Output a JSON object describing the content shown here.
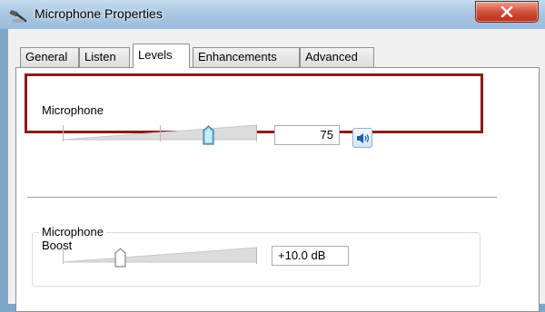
{
  "window": {
    "title": "Microphone Properties",
    "icon": "microphone-icon",
    "close_icon": "close-icon"
  },
  "tabs": [
    {
      "label": "General",
      "active": false
    },
    {
      "label": "Listen",
      "active": false
    },
    {
      "label": "Levels",
      "active": true
    },
    {
      "label": "Enhancements",
      "active": false
    },
    {
      "label": "Advanced",
      "active": false
    }
  ],
  "levels": {
    "microphone": {
      "label": "Microphone",
      "value": "75",
      "slider_value": 75,
      "mute_icon": "speaker-icon"
    },
    "boost": {
      "label": "Microphone Boost",
      "value": "+10.0 dB",
      "slider_value_fraction": 0.25
    }
  },
  "colors": {
    "highlight": "#8b1a1a",
    "close_button": "#c8402a",
    "titlebar": "#a9c7e3"
  }
}
